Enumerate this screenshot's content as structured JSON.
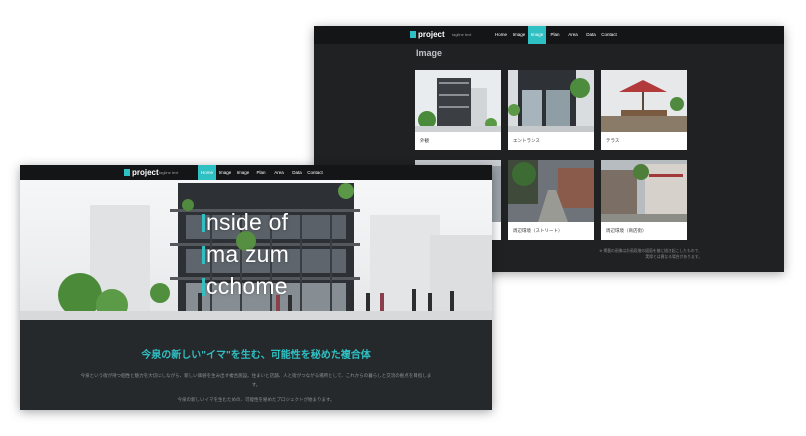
{
  "logo": {
    "text": "project"
  },
  "tagline": "tagline text",
  "nav": {
    "items": [
      {
        "label": "Home"
      },
      {
        "label": "Image"
      },
      {
        "label": "Image"
      },
      {
        "label": "Plan"
      },
      {
        "label": "Area"
      },
      {
        "label": "Data"
      },
      {
        "label": "Contact"
      }
    ],
    "back_active_index": 2,
    "front_active_index": 0
  },
  "back_page": {
    "title": "Image",
    "cards": [
      {
        "caption": "外観"
      },
      {
        "caption": "エントランス"
      },
      {
        "caption": "テラス"
      },
      {
        "caption": ""
      },
      {
        "caption": "周辺環境（ストリート）"
      },
      {
        "caption": "周辺環境（商店街）"
      }
    ],
    "footer_lines": [
      "※ 掲載の画像は計画段階の図面を基に描き起こしたもので、",
      "実際とは異なる場合があります。"
    ]
  },
  "front_page": {
    "hero_lines": [
      "nside of",
      "ma zum",
      "cchome"
    ],
    "headline": "今泉の新しい\"イマ\"を生む、可能性を秘めた複合体",
    "paragraph_1": "今泉という街が持つ個性と魅力を大切にしながら、新しい価値を生み出す複合施設。住まいと店舗、人と街がつながる場所として、これからの暮らしと交流の拠点を目指します。",
    "paragraph_2": "今泉の新しいイマを生むための、可能性を秘めたプロジェクトが始まります。"
  },
  "colors": {
    "accent": "#2fc0c4",
    "dark_bg": "#1f2123",
    "nav_bg": "#141516",
    "front_body_bg": "#26292c"
  }
}
